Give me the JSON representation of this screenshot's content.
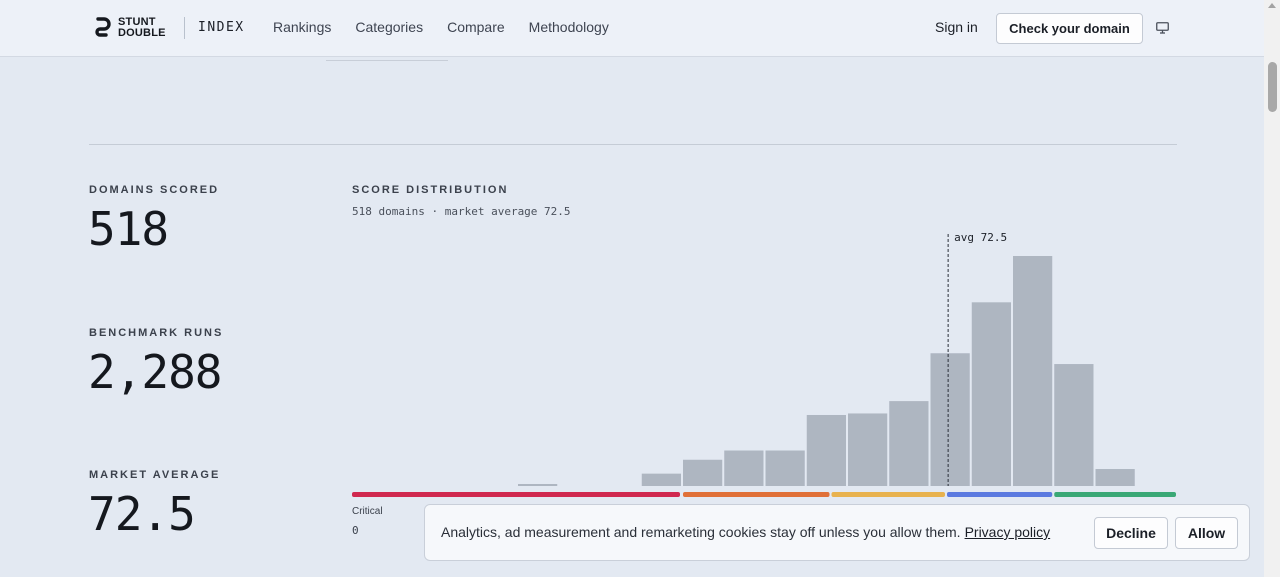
{
  "header": {
    "brand_line1": "STUNT",
    "brand_line2": "DOUBLE",
    "index_label": "INDEX",
    "nav": [
      "Rankings",
      "Categories",
      "Compare",
      "Methodology"
    ],
    "sign_in": "Sign in",
    "cta": "Check your domain",
    "theme_icon": "monitor-icon"
  },
  "stats": {
    "domains_label": "DOMAINS SCORED",
    "domains_value": "518",
    "runs_label": "BENCHMARK RUNS",
    "runs_value": "2,288",
    "avg_label": "MARKET AVERAGE",
    "avg_value": "72.5"
  },
  "distribution": {
    "title": "SCORE DISTRIBUTION",
    "subtitle": "518 domains · market average 72.5",
    "critical_label": "Critical",
    "zero_label": "0"
  },
  "chart_data": {
    "type": "bar",
    "x_range": [
      0,
      100
    ],
    "bin_width": 5,
    "bins": [
      0,
      5,
      10,
      15,
      20,
      25,
      30,
      35,
      40,
      45,
      50,
      55,
      60,
      65,
      70,
      75,
      80,
      85,
      90,
      95
    ],
    "values": [
      0,
      0,
      0,
      0,
      1,
      0,
      0,
      8,
      17,
      23,
      23,
      46,
      47,
      55,
      86,
      119,
      149,
      79,
      11,
      0
    ],
    "average": 72.5,
    "average_label": "avg 72.5",
    "bar_color": "#aeb6c1",
    "bands": [
      {
        "from": 0,
        "to": 40,
        "color": "#d0284f"
      },
      {
        "from": 40,
        "to": 58,
        "color": "#e07038"
      },
      {
        "from": 58,
        "to": 72,
        "color": "#e8b24e"
      },
      {
        "from": 72,
        "to": 85,
        "color": "#5b7ae0"
      },
      {
        "from": 85,
        "to": 100,
        "color": "#3aa876"
      }
    ]
  },
  "cookie": {
    "text": "Analytics, ad measurement and remarketing cookies stay off unless you allow them.",
    "link": "Privacy policy",
    "decline": "Decline",
    "allow": "Allow"
  }
}
